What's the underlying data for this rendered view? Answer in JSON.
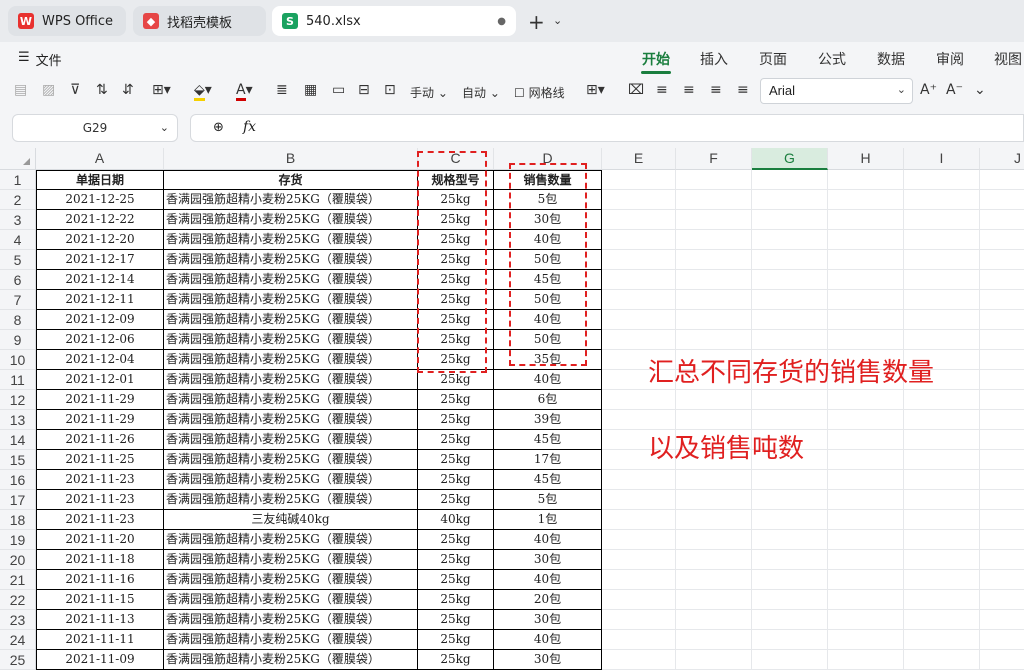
{
  "tabs": {
    "wps": "WPS Office",
    "template": "找稻壳模板",
    "doc": "540.xlsx",
    "new": "+"
  },
  "menu": {
    "file": "文件",
    "ribbon": [
      "开始",
      "插入",
      "页面",
      "公式",
      "数据",
      "审阅",
      "视图"
    ]
  },
  "toolbar": {
    "manual": "手动",
    "auto": "自动",
    "gridlines": "网格线",
    "font": "Arial"
  },
  "formula": {
    "cell_ref": "G29",
    "fx": "fx"
  },
  "columns": [
    "A",
    "B",
    "C",
    "D",
    "E",
    "F",
    "G",
    "H",
    "I",
    "J"
  ],
  "header_row": [
    "单据日期",
    "存货",
    "规格型号",
    "销售数量"
  ],
  "rows": [
    [
      "2021-12-25",
      "香满园强筋超精小麦粉25KG（覆膜袋）",
      "25kg",
      "5包"
    ],
    [
      "2021-12-22",
      "香满园强筋超精小麦粉25KG（覆膜袋）",
      "25kg",
      "30包"
    ],
    [
      "2021-12-20",
      "香满园强筋超精小麦粉25KG（覆膜袋）",
      "25kg",
      "40包"
    ],
    [
      "2021-12-17",
      "香满园强筋超精小麦粉25KG（覆膜袋）",
      "25kg",
      "50包"
    ],
    [
      "2021-12-14",
      "香满园强筋超精小麦粉25KG（覆膜袋）",
      "25kg",
      "45包"
    ],
    [
      "2021-12-11",
      "香满园强筋超精小麦粉25KG（覆膜袋）",
      "25kg",
      "50包"
    ],
    [
      "2021-12-09",
      "香满园强筋超精小麦粉25KG（覆膜袋）",
      "25kg",
      "40包"
    ],
    [
      "2021-12-06",
      "香满园强筋超精小麦粉25KG（覆膜袋）",
      "25kg",
      "50包"
    ],
    [
      "2021-12-04",
      "香满园强筋超精小麦粉25KG（覆膜袋）",
      "25kg",
      "35包"
    ],
    [
      "2021-12-01",
      "香满园强筋超精小麦粉25KG（覆膜袋）",
      "25kg",
      "40包"
    ],
    [
      "2021-11-29",
      "香满园强筋超精小麦粉25KG（覆膜袋）",
      "25kg",
      "6包"
    ],
    [
      "2021-11-29",
      "香满园强筋超精小麦粉25KG（覆膜袋）",
      "25kg",
      "39包"
    ],
    [
      "2021-11-26",
      "香满园强筋超精小麦粉25KG（覆膜袋）",
      "25kg",
      "45包"
    ],
    [
      "2021-11-25",
      "香满园强筋超精小麦粉25KG（覆膜袋）",
      "25kg",
      "17包"
    ],
    [
      "2021-11-23",
      "香满园强筋超精小麦粉25KG（覆膜袋）",
      "25kg",
      "45包"
    ],
    [
      "2021-11-23",
      "香满园强筋超精小麦粉25KG（覆膜袋）",
      "25kg",
      "5包"
    ],
    [
      "2021-11-23",
      "三友纯碱40kg",
      "40kg",
      "1包"
    ],
    [
      "2021-11-20",
      "香满园强筋超精小麦粉25KG（覆膜袋）",
      "25kg",
      "40包"
    ],
    [
      "2021-11-18",
      "香满园强筋超精小麦粉25KG（覆膜袋）",
      "25kg",
      "30包"
    ],
    [
      "2021-11-16",
      "香满园强筋超精小麦粉25KG（覆膜袋）",
      "25kg",
      "40包"
    ],
    [
      "2021-11-15",
      "香满园强筋超精小麦粉25KG（覆膜袋）",
      "25kg",
      "20包"
    ],
    [
      "2021-11-13",
      "香满园强筋超精小麦粉25KG（覆膜袋）",
      "25kg",
      "30包"
    ],
    [
      "2021-11-11",
      "香满园强筋超精小麦粉25KG（覆膜袋）",
      "25kg",
      "40包"
    ],
    [
      "2021-11-09",
      "香满园强筋超精小麦粉25KG（覆膜袋）",
      "25kg",
      "30包"
    ]
  ],
  "annotations": {
    "line1": "汇总不同存货的销售数量",
    "line2": "以及销售吨数"
  },
  "colors": {
    "accent": "#1a7e3e",
    "annotation": "#e02020"
  }
}
